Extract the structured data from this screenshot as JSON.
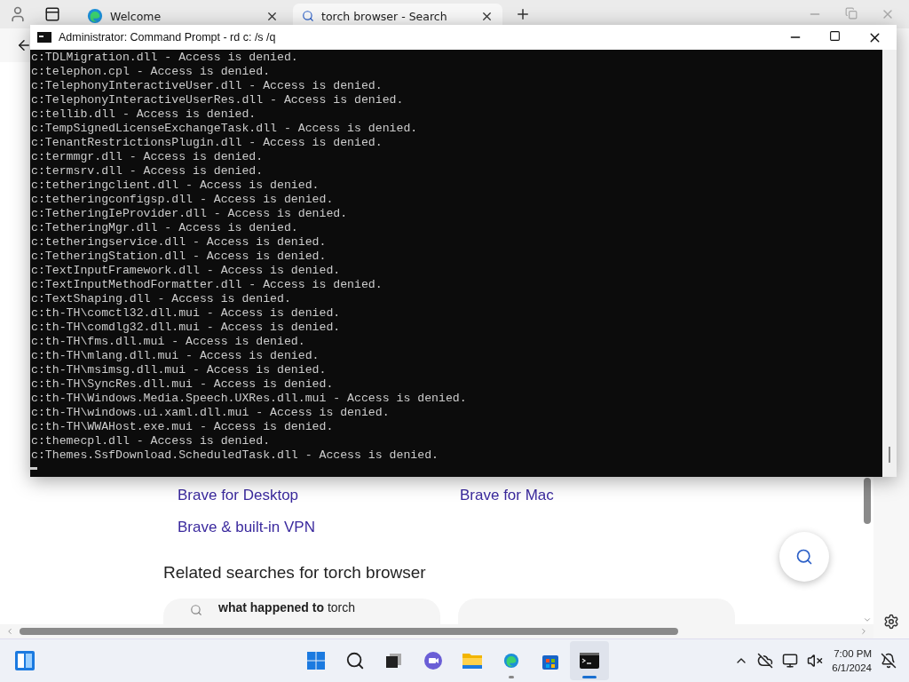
{
  "browser": {
    "tabs": [
      {
        "title": "Welcome",
        "kind": "edge",
        "selected": false
      },
      {
        "title": "torch browser - Search",
        "kind": "search",
        "selected": true
      }
    ],
    "page": {
      "links": [
        "Brave for Desktop",
        "Brave for Mac",
        "Brave & built-in VPN"
      ],
      "related_heading": "Related searches for torch browser",
      "related_searches": [
        {
          "text": "**what happened to** torch"
        }
      ]
    }
  },
  "console_window": {
    "title": "Administrator: Command Prompt - rd  c: /s /q",
    "lines": [
      "c:TDLMigration.dll - Access is denied.",
      "c:telephon.cpl - Access is denied.",
      "c:TelephonyInteractiveUser.dll - Access is denied.",
      "c:TelephonyInteractiveUserRes.dll - Access is denied.",
      "c:tellib.dll - Access is denied.",
      "c:TempSignedLicenseExchangeTask.dll - Access is denied.",
      "c:TenantRestrictionsPlugin.dll - Access is denied.",
      "c:termmgr.dll - Access is denied.",
      "c:termsrv.dll - Access is denied.",
      "c:tetheringclient.dll - Access is denied.",
      "c:tetheringconfigsp.dll - Access is denied.",
      "c:TetheringIeProvider.dll - Access is denied.",
      "c:TetheringMgr.dll - Access is denied.",
      "c:tetheringservice.dll - Access is denied.",
      "c:TetheringStation.dll - Access is denied.",
      "c:TextInputFramework.dll - Access is denied.",
      "c:TextInputMethodFormatter.dll - Access is denied.",
      "c:TextShaping.dll - Access is denied.",
      "c:th-TH\\comctl32.dll.mui - Access is denied.",
      "c:th-TH\\comdlg32.dll.mui - Access is denied.",
      "c:th-TH\\fms.dll.mui - Access is denied.",
      "c:th-TH\\mlang.dll.mui - Access is denied.",
      "c:th-TH\\msimsg.dll.mui - Access is denied.",
      "c:th-TH\\SyncRes.dll.mui - Access is denied.",
      "c:th-TH\\Windows.Media.Speech.UXRes.dll.mui - Access is denied.",
      "c:th-TH\\windows.ui.xaml.dll.mui - Access is denied.",
      "c:th-TH\\WWAHost.exe.mui - Access is denied.",
      "c:themecpl.dll - Access is denied.",
      "c:Themes.SsfDownload.ScheduledTask.dll - Access is denied."
    ]
  },
  "taskbar": {
    "apps": [
      {
        "kind": "start",
        "running": false,
        "active": false
      },
      {
        "kind": "search",
        "running": false,
        "active": false
      },
      {
        "kind": "taskview",
        "running": false,
        "active": false
      },
      {
        "kind": "chat",
        "running": false,
        "active": false
      },
      {
        "kind": "explorer",
        "running": false,
        "active": false
      },
      {
        "kind": "edge",
        "running": true,
        "active": false
      },
      {
        "kind": "store",
        "running": false,
        "active": false
      },
      {
        "kind": "terminal",
        "running": true,
        "active": true
      }
    ],
    "time": "7:00 PM",
    "date": "6/1/2024"
  }
}
